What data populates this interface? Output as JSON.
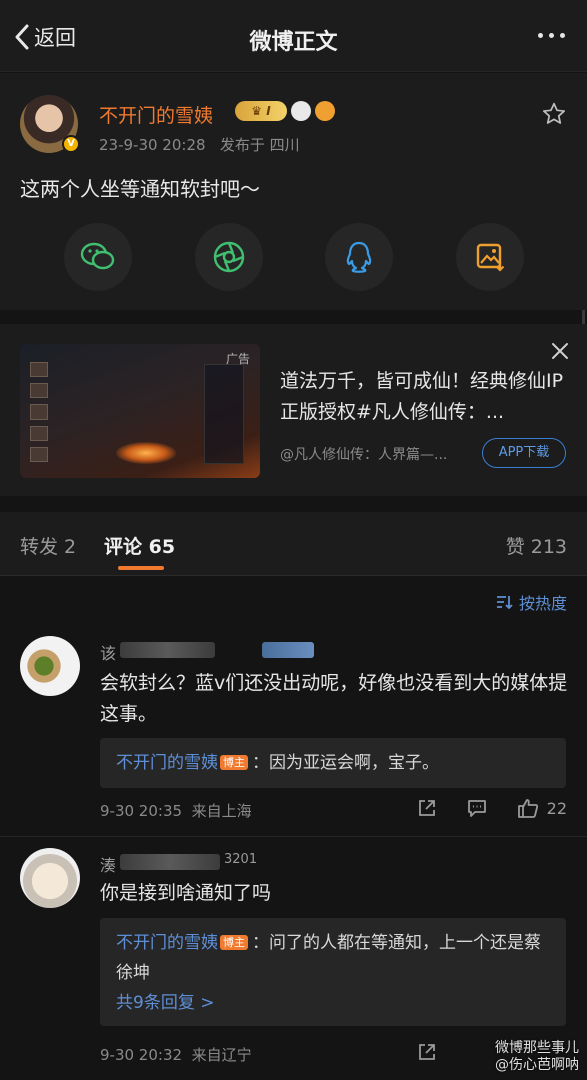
{
  "nav": {
    "back_label": "返回",
    "title": "微博正文"
  },
  "post": {
    "author": "不开门的雪姨",
    "level": "I",
    "time": "23-9-30 20:28",
    "location": "发布于 四川",
    "text": "这两个人坐等通知软封吧～"
  },
  "share": [
    "wechat-icon",
    "moments-icon",
    "qq-icon",
    "save-image-icon"
  ],
  "ad": {
    "tag": "广告",
    "text": "道法万千，皆可成仙！经典修仙IP正版授权#凡人修仙传：...",
    "source": "@凡人修仙传：人界篇—...",
    "button": "APP下载"
  },
  "tabs": {
    "repost": "转发 2",
    "comments": "评论 65",
    "likes": "赞 213"
  },
  "sort_label": "按热度",
  "comments": [
    {
      "name_prefix": "该",
      "text": "会软封么？蓝v们还没出动呢，好像也没看到大的媒体提这事。",
      "reply_author": "不开门的雪姨",
      "reply_tag": "博主",
      "reply_text": "：因为亚运会啊，宝子。",
      "time": "9-30 20:35",
      "from": "来自上海",
      "likes": "22"
    },
    {
      "name_prefix": "湊",
      "name_suffix": "3201",
      "text": "你是接到啥通知了吗",
      "reply_author": "不开门的雪姨",
      "reply_tag": "博主",
      "reply_text": "：问了的人都在等通知，上一个还是蔡徐坤",
      "reply_more": "共9条回复 >",
      "time": "9-30 20:32",
      "from": "来自辽宁"
    }
  ],
  "watermark": {
    "line1": "微博那些事儿",
    "line2": "@伤心芭啊呐"
  },
  "colors": {
    "accent": "#f07a2f",
    "link": "#5e8fd6",
    "background": "#141414",
    "card": "#1c1c1c"
  }
}
